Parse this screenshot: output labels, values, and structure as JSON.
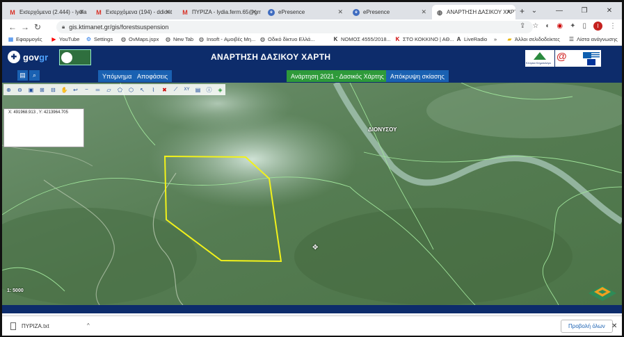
{
  "tabs": [
    {
      "title": "Εισερχόμενα (2.444) - lydia",
      "icon": "gmail-icon",
      "active": false
    },
    {
      "title": "Εισερχόμενα (194) - ddiont",
      "icon": "gmail-icon",
      "active": false
    },
    {
      "title": "ΠΥΡΙΖΑ - lydia.ferm.65@gm",
      "icon": "gmail-icon",
      "active": false
    },
    {
      "title": "ePresence",
      "icon": "epresence-icon",
      "active": false
    },
    {
      "title": "ePresence",
      "icon": "epresence-icon",
      "active": false
    },
    {
      "title": "ΑΝΑΡΤΗΣΗ ΔΑΣΙΚΟΥ ΧΑΡΤΗ",
      "icon": "globe-icon",
      "active": true
    }
  ],
  "address": {
    "url": "gis.ktimanet.gr/gis/forestsuspension"
  },
  "bookmarks": [
    {
      "label": "Εφαρμογές",
      "icon": "apps-grid-icon"
    },
    {
      "label": "YouTube",
      "icon": "youtube-icon"
    },
    {
      "label": "Settings",
      "icon": "gear-icon"
    },
    {
      "label": "OvMaps.jspx",
      "icon": "globe-icon"
    },
    {
      "label": "New Tab",
      "icon": "globe-icon"
    },
    {
      "label": "Insoft - Αμοιβές Μη...",
      "icon": "globe-icon"
    },
    {
      "label": "Οδικό δίκτυο Ελλά...",
      "icon": "globe-icon"
    },
    {
      "label": "ΝΟΜΟΣ 4555/2018...",
      "icon": "k-icon"
    },
    {
      "label": "ΣΤΟ ΚΟΚΚΙΝΟ | ΑΘ...",
      "icon": "k-icon"
    },
    {
      "label": "LiveRadio",
      "icon": "a-icon"
    },
    {
      "label": "»",
      "icon": ""
    },
    {
      "label": "Άλλοι σελιδοδείκτες",
      "icon": "folder-icon"
    },
    {
      "label": "Λίστα ανάγνωσης",
      "icon": "reading-list-icon"
    }
  ],
  "header": {
    "logo_text_1": "gov",
    "logo_text_2": "gr",
    "title": "ΑΝΑΡΤΗΣΗ ΔΑΣΙΚΟΥ ΧΑΡΤΗ",
    "ktimatologio_caption": "Ελληνικό Κτηματολόγιο"
  },
  "nav": {
    "legend": "Υπόμνημα",
    "decisions": "Αποφάσεις",
    "map_select": "Ανάρτηση 2021 - Δασικός Χάρτης",
    "hide_shading": "Απόκρυψη σκίασης"
  },
  "map": {
    "coordinates": "X: 491968.913 , Y: 4213964.705",
    "place_label": "ΔΙΟΝΥΣΟΥ",
    "scale": "1: 5000",
    "polygon_color": "#f2f21a",
    "boundary_color": "#9fe39a"
  },
  "downloads": {
    "file": "ΠΥΡΙΖΑ.txt",
    "show_all": "Προβολή όλων"
  },
  "user": {
    "avatar_letter": "I"
  }
}
